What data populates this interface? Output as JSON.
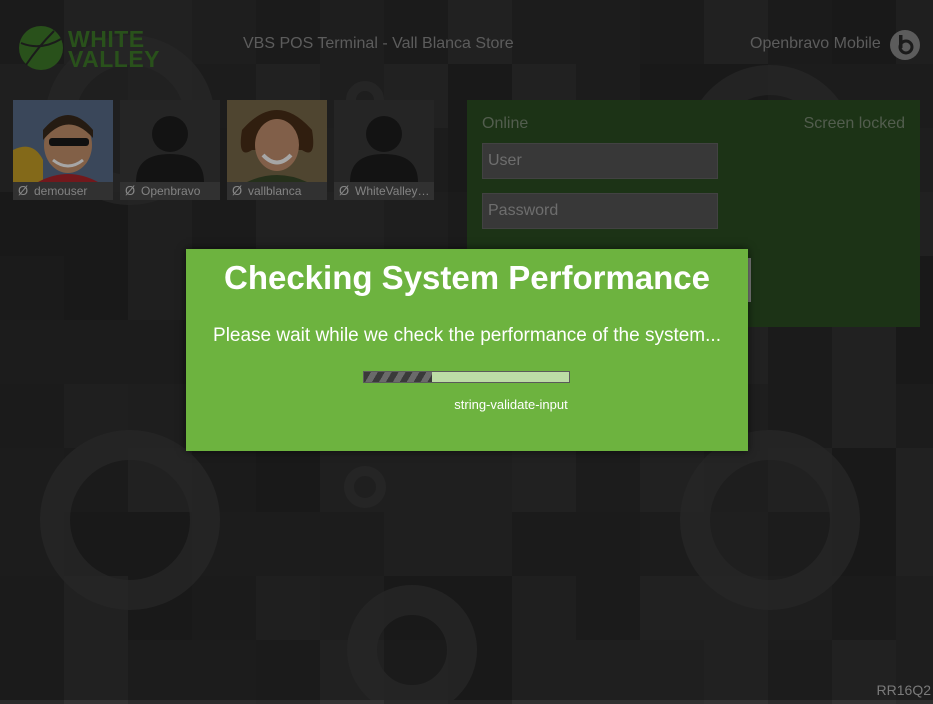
{
  "header": {
    "brand_line1": "WHITE",
    "brand_line2": "VALLEY",
    "terminal_title": "VBS POS Terminal - Vall Blanca Store",
    "app_name": "Openbravo Mobile",
    "app_icon": "openbravo-logo-icon"
  },
  "users": [
    {
      "name": "demouser",
      "status_icon": "Ø",
      "avatar": "photo"
    },
    {
      "name": "Openbravo",
      "status_icon": "Ø",
      "avatar": "silhouette"
    },
    {
      "name": "vallblanca",
      "status_icon": "Ø",
      "avatar": "photo"
    },
    {
      "name": "WhiteValley…",
      "status_icon": "Ø",
      "avatar": "silhouette"
    }
  ],
  "login": {
    "status": "Online",
    "lock_state": "Screen locked",
    "user_placeholder": "User",
    "password_placeholder": "Password"
  },
  "modal": {
    "title": "Checking System Performance",
    "message": "Please wait while we check the performance of the system...",
    "progress_fraction": 0.33,
    "progress_label": "string-validate-input"
  },
  "footer": {
    "version": "RR16Q2"
  },
  "colors": {
    "brand_green": "#3f7d2a",
    "modal_green": "#6db33f",
    "panel_green": "#2c4f22",
    "background": "#2a2a2a"
  }
}
